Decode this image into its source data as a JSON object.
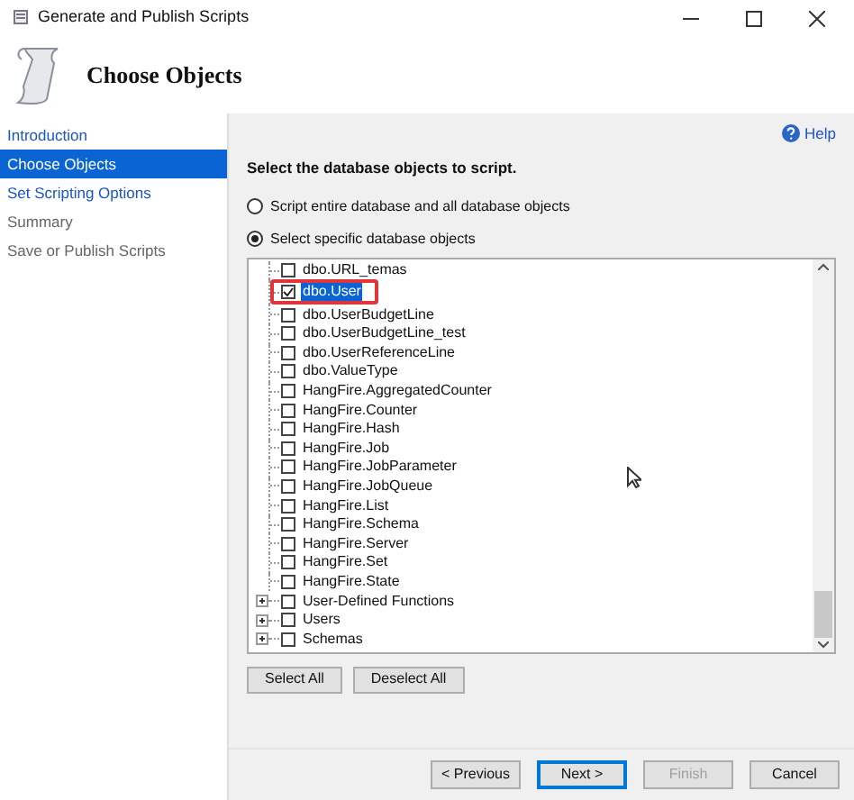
{
  "window": {
    "title": "Generate and Publish Scripts"
  },
  "header": {
    "title": "Choose Objects"
  },
  "nav": [
    {
      "label": "Introduction",
      "selected": false,
      "disabled": false
    },
    {
      "label": "Choose Objects",
      "selected": true,
      "disabled": false
    },
    {
      "label": "Set Scripting Options",
      "selected": false,
      "disabled": false
    },
    {
      "label": "Summary",
      "selected": false,
      "disabled": true
    },
    {
      "label": "Save or Publish Scripts",
      "selected": false,
      "disabled": true
    }
  ],
  "help": "Help",
  "instruction": "Select the database objects to script.",
  "options": [
    {
      "label": "Script entire database and all database objects",
      "selected": false
    },
    {
      "label": "Select specific database objects",
      "selected": true
    }
  ],
  "tree": [
    {
      "kind": "leaf",
      "label": "dbo.URL_temas",
      "checked": false,
      "selected": false,
      "outlined": false
    },
    {
      "kind": "leaf",
      "label": "dbo.User",
      "checked": true,
      "selected": true,
      "outlined": true
    },
    {
      "kind": "leaf",
      "label": "dbo.UserBudgetLine",
      "checked": false,
      "selected": false,
      "outlined": false
    },
    {
      "kind": "leaf",
      "label": "dbo.UserBudgetLine_test",
      "checked": false,
      "selected": false,
      "outlined": false
    },
    {
      "kind": "leaf",
      "label": "dbo.UserReferenceLine",
      "checked": false,
      "selected": false,
      "outlined": false
    },
    {
      "kind": "leaf",
      "label": "dbo.ValueType",
      "checked": false,
      "selected": false,
      "outlined": false
    },
    {
      "kind": "leaf",
      "label": "HangFire.AggregatedCounter",
      "checked": false,
      "selected": false,
      "outlined": false
    },
    {
      "kind": "leaf",
      "label": "HangFire.Counter",
      "checked": false,
      "selected": false,
      "outlined": false
    },
    {
      "kind": "leaf",
      "label": "HangFire.Hash",
      "checked": false,
      "selected": false,
      "outlined": false
    },
    {
      "kind": "leaf",
      "label": "HangFire.Job",
      "checked": false,
      "selected": false,
      "outlined": false
    },
    {
      "kind": "leaf",
      "label": "HangFire.JobParameter",
      "checked": false,
      "selected": false,
      "outlined": false
    },
    {
      "kind": "leaf",
      "label": "HangFire.JobQueue",
      "checked": false,
      "selected": false,
      "outlined": false
    },
    {
      "kind": "leaf",
      "label": "HangFire.List",
      "checked": false,
      "selected": false,
      "outlined": false
    },
    {
      "kind": "leaf",
      "label": "HangFire.Schema",
      "checked": false,
      "selected": false,
      "outlined": false
    },
    {
      "kind": "leaf",
      "label": "HangFire.Server",
      "checked": false,
      "selected": false,
      "outlined": false
    },
    {
      "kind": "leaf",
      "label": "HangFire.Set",
      "checked": false,
      "selected": false,
      "outlined": false
    },
    {
      "kind": "leaf",
      "label": "HangFire.State",
      "checked": false,
      "selected": false,
      "outlined": false
    },
    {
      "kind": "group",
      "label": "User-Defined Functions",
      "checked": false,
      "selected": false,
      "outlined": false,
      "expanded": false
    },
    {
      "kind": "group",
      "label": "Users",
      "checked": false,
      "selected": false,
      "outlined": false,
      "expanded": false
    },
    {
      "kind": "group",
      "label": "Schemas",
      "checked": false,
      "selected": false,
      "outlined": false,
      "expanded": false
    }
  ],
  "tree_buttons": [
    "Select All",
    "Deselect All"
  ],
  "footer_buttons": [
    {
      "label": "< Previous",
      "disabled": false,
      "default": false
    },
    {
      "label": "Next >",
      "disabled": false,
      "default": true
    },
    {
      "label": "Finish",
      "disabled": true,
      "default": false
    },
    {
      "label": "Cancel",
      "disabled": false,
      "default": false
    }
  ]
}
